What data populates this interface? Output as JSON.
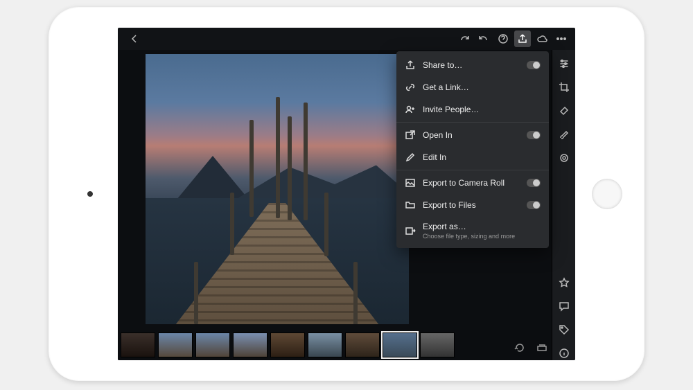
{
  "share_menu": {
    "items": [
      {
        "icon": "share-icon",
        "label": "Share to…",
        "has_toggle": true
      },
      {
        "icon": "link-icon",
        "label": "Get a Link…",
        "has_toggle": false
      },
      {
        "icon": "invite-icon",
        "label": "Invite People…",
        "has_toggle": false
      },
      {
        "icon": "open-in-icon",
        "label": "Open In",
        "has_toggle": true
      },
      {
        "icon": "edit-in-icon",
        "label": "Edit In",
        "has_toggle": false
      },
      {
        "icon": "camera-roll-icon",
        "label": "Export to Camera Roll",
        "has_toggle": true
      },
      {
        "icon": "folder-icon",
        "label": "Export to Files",
        "has_toggle": true
      },
      {
        "icon": "export-as-icon",
        "label": "Export as…",
        "sub": "Choose file type, sizing and more",
        "has_toggle": false
      }
    ]
  },
  "toolbar": {
    "back": "‹"
  }
}
